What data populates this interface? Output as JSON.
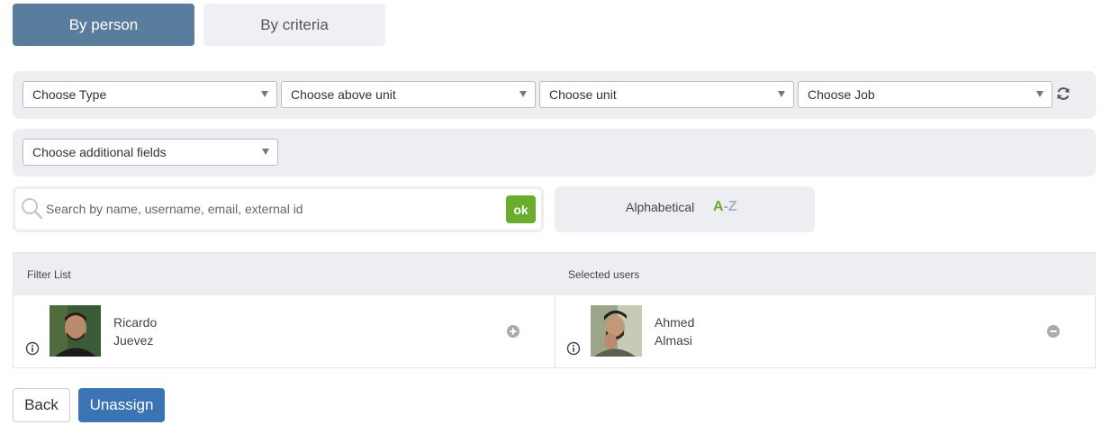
{
  "tabs": [
    {
      "label": "By person",
      "active": true
    },
    {
      "label": "By criteria",
      "active": false
    }
  ],
  "filters": {
    "type": "Choose Type",
    "above_unit": "Choose above unit",
    "unit": "Choose unit",
    "job": "Choose Job",
    "additional_fields": "Choose additional fields"
  },
  "search": {
    "placeholder": "Search by name, username, email, external id",
    "value": "",
    "ok_label": "ok"
  },
  "sort": {
    "label": "Alphabetical",
    "a": "A",
    "dash": "-",
    "z": "Z"
  },
  "filter_list": {
    "header": "Filter List",
    "users": [
      {
        "first_name": "Ricardo",
        "last_name": "Juevez",
        "action_icon": "plus-circle-icon"
      }
    ]
  },
  "selected_users": {
    "header": "Selected users",
    "users": [
      {
        "first_name": "Ahmed",
        "last_name": "Almasi",
        "action_icon": "minus-circle-icon"
      }
    ]
  },
  "buttons": {
    "back": "Back",
    "unassign": "Unassign"
  },
  "colors": {
    "primary": "#3a74b4",
    "tab_active": "#5a7d9d",
    "ok_green": "#6aac2e",
    "panel_bg": "#edeef1"
  }
}
